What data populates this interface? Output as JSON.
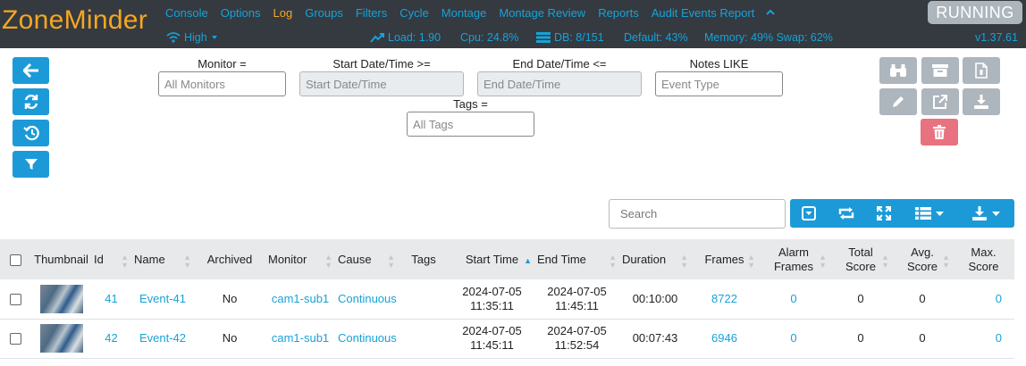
{
  "brand": "ZoneMinder",
  "menu": [
    {
      "label": "Console",
      "active": false
    },
    {
      "label": "Options",
      "active": false
    },
    {
      "label": "Log",
      "active": true
    },
    {
      "label": "Groups",
      "active": false
    },
    {
      "label": "Filters",
      "active": false
    },
    {
      "label": "Cycle",
      "active": false
    },
    {
      "label": "Montage",
      "active": false
    },
    {
      "label": "Montage Review",
      "active": false
    },
    {
      "label": "Reports",
      "active": false
    },
    {
      "label": "Audit Events Report",
      "active": false
    }
  ],
  "menu_collapse_icon": "chevron-up-icon",
  "status_label": "RUNNING",
  "sysbar": {
    "bandwidth": "High",
    "load": "Load: 1.90",
    "cpu": "Cpu: 24.8%",
    "db": "DB: 8/151",
    "default": "Default: 43%",
    "memory": "Memory: 49% Swap: 62%",
    "version": "v1.37.61"
  },
  "left_buttons": [
    "back-arrow-icon",
    "refresh-icon",
    "history-icon",
    "filter-icon"
  ],
  "filters": {
    "monitor_label": "Monitor  =",
    "monitor_placeholder": "All Monitors",
    "start_label": "Start Date/Time  >=",
    "start_placeholder": "Start Date/Time",
    "end_label": "End Date/Time  <=",
    "end_placeholder": "End Date/Time",
    "notes_label": "Notes  LIKE",
    "notes_placeholder": "Event Type",
    "tags_label": "Tags  =",
    "tags_placeholder": "All Tags"
  },
  "action_buttons": [
    "binoculars-icon",
    "archive-icon",
    "file-icon",
    "pencil-icon",
    "external-link-icon",
    "download-icon",
    "trash-icon"
  ],
  "search_placeholder": "Search",
  "toolbar_icons": [
    "toggle-icon",
    "refresh-icon",
    "fullscreen-icon",
    "columns-icon",
    "export-icon"
  ],
  "table": {
    "headers": {
      "thumbnail": "Thumbnail",
      "id": "Id",
      "name": "Name",
      "archived": "Archived",
      "monitor": "Monitor",
      "cause": "Cause",
      "tags": "Tags",
      "start_time": "Start Time",
      "end_time": "End Time",
      "duration": "Duration",
      "frames": "Frames",
      "alarm_frames_1": "Alarm",
      "alarm_frames_2": "Frames",
      "total_score_1": "Total",
      "total_score_2": "Score",
      "avg_score_1": "Avg.",
      "avg_score_2": "Score",
      "max_score_1": "Max.",
      "max_score_2": "Score"
    },
    "rows": [
      {
        "id": "41",
        "name": "Event-41",
        "archived": "No",
        "monitor": "cam1-sub1",
        "cause": "Continuous",
        "tags": "",
        "start_date": "2024-07-05",
        "start_clock": "11:35:11",
        "end_date": "2024-07-05",
        "end_clock": "11:45:11",
        "duration": "00:10:00",
        "frames": "8722",
        "alarm_frames": "0",
        "total_score": "0",
        "avg_score": "0",
        "max_score": "0"
      },
      {
        "id": "42",
        "name": "Event-42",
        "archived": "No",
        "monitor": "cam1-sub1",
        "cause": "Continuous",
        "tags": "",
        "start_date": "2024-07-05",
        "start_clock": "11:45:11",
        "end_date": "2024-07-05",
        "end_clock": "11:52:54",
        "duration": "00:07:43",
        "frames": "6946",
        "alarm_frames": "0",
        "total_score": "0",
        "avg_score": "0",
        "max_score": "0"
      }
    ]
  },
  "colors": {
    "nav_bg": "#343a40",
    "brand": "#f5a623",
    "link": "#17a2d8",
    "primary": "#1c9ad8",
    "secondary": "#adb5bd",
    "danger": "#e8727f"
  }
}
